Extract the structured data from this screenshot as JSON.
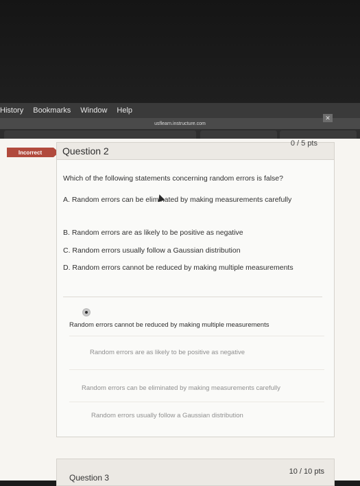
{
  "menu": [
    "History",
    "Bookmarks",
    "Window",
    "Help"
  ],
  "url": "usflearn.instructure.com",
  "close_glyph": "✕",
  "question": {
    "status_badge": "Incorrect",
    "title": "Question 2",
    "points": "0 / 5 pts",
    "text": "Which of the following statements concerning random errors is false?",
    "choices": [
      "A. Random errors can be eliminated by making measurements carefully",
      "B. Random errors are as likely to be positive as negative",
      "C. Random errors usually follow a Gaussian distribution",
      "D. Random errors cannot be reduced by making multiple measurements"
    ],
    "answers": [
      {
        "text": "Random errors cannot be reduced by making multiple measurements",
        "selected": true
      },
      {
        "text": "Random errors are as likely to be positive as negative",
        "selected": false
      },
      {
        "text": "Random errors can be eliminated by making measurements carefully",
        "selected": false
      },
      {
        "text": "Random errors usually follow a Gaussian distribution",
        "selected": false
      }
    ]
  },
  "next_question": {
    "title": "Question 3",
    "points": "10 / 10 pts"
  },
  "colors": {
    "incorrect_badge": "#b14a3d",
    "background": "#f7f5f1"
  }
}
